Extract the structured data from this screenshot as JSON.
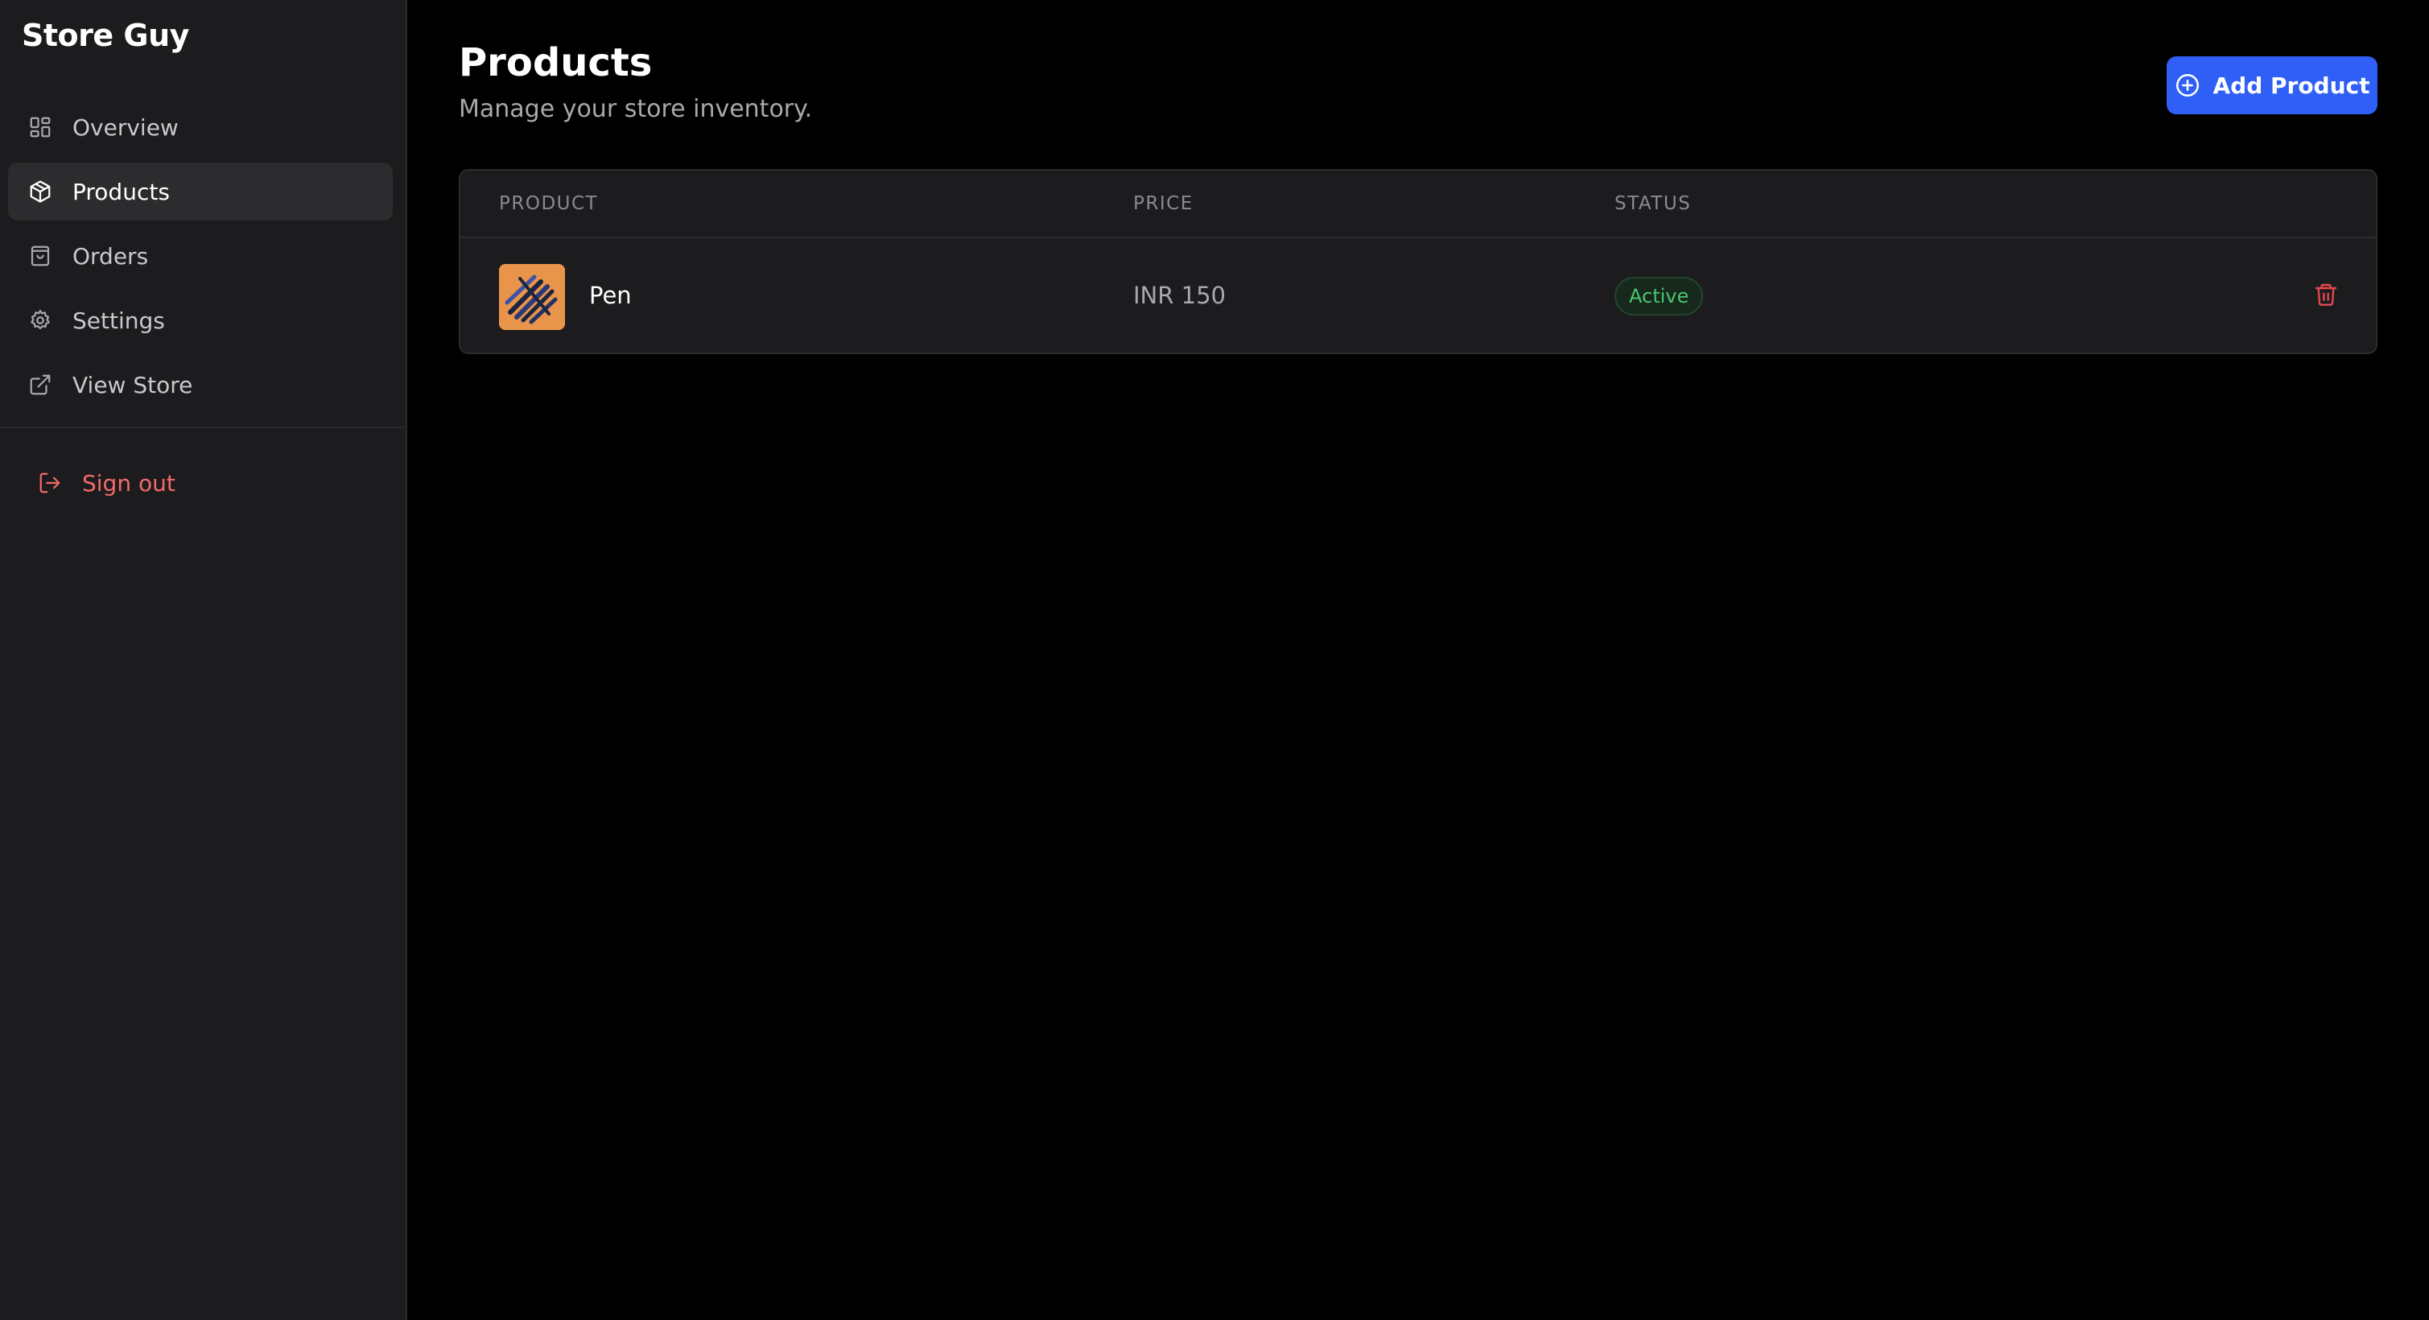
{
  "app": {
    "brand": "Store Guy"
  },
  "sidebar": {
    "items": [
      {
        "label": "Overview",
        "icon": "grid-icon",
        "active": false
      },
      {
        "label": "Products",
        "icon": "package-icon",
        "active": true
      },
      {
        "label": "Orders",
        "icon": "shopping-bag-icon",
        "active": false
      },
      {
        "label": "Settings",
        "icon": "gear-icon",
        "active": false
      },
      {
        "label": "View Store",
        "icon": "external-link-icon",
        "active": false
      }
    ],
    "signout": {
      "label": "Sign out",
      "icon": "sign-out-icon"
    }
  },
  "header": {
    "title": "Products",
    "subtitle": "Manage your store inventory.",
    "add_button": {
      "label": "Add Product",
      "icon": "plus-circle-icon"
    }
  },
  "table": {
    "columns": [
      "PRODUCT",
      "PRICE",
      "STATUS"
    ],
    "rows": [
      {
        "name": "Pen",
        "price": "INR 150",
        "status": "Active",
        "thumbnail_icon": "product-thumbnail",
        "delete_icon": "trash-icon"
      }
    ]
  },
  "colors": {
    "background": "#000000",
    "sidebar": "#1c1c1e",
    "accent": "#2f5ff5",
    "danger": "#f36a6a",
    "status_active": "#4cc46f"
  }
}
